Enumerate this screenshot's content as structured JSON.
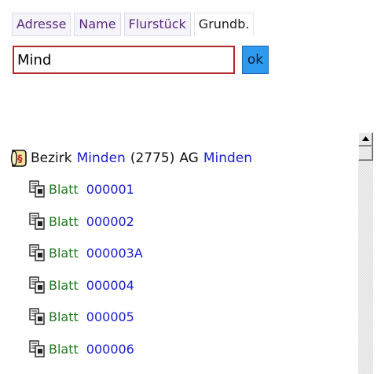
{
  "tabs": [
    {
      "label": "Adresse",
      "active": false
    },
    {
      "label": "Name",
      "active": false
    },
    {
      "label": "Flurstück",
      "active": false
    },
    {
      "label": "Grundb.",
      "active": true
    }
  ],
  "search": {
    "value": "Mind",
    "button_label": "ok"
  },
  "district": {
    "icon": "paragraph-seal-icon",
    "prefix": "Bezirk",
    "name": "Minden",
    "code": "(2775)",
    "court_prefix": "AG",
    "court": "Minden"
  },
  "sheets": [
    {
      "label": "Blatt",
      "number": "000001",
      "icon": "register-sheet-icon"
    },
    {
      "label": "Blatt",
      "number": "000002",
      "icon": "register-sheet-icon"
    },
    {
      "label": "Blatt",
      "number": "000003A",
      "icon": "register-sheet-icon"
    },
    {
      "label": "Blatt",
      "number": "000004",
      "icon": "register-sheet-icon"
    },
    {
      "label": "Blatt",
      "number": "000005",
      "icon": "register-sheet-icon"
    },
    {
      "label": "Blatt",
      "number": "000006",
      "icon": "register-sheet-icon"
    }
  ],
  "colors": {
    "tab_text": "#5c2a7e",
    "input_border": "#b3282d",
    "ok_button": "#2e9bf0",
    "link_blue": "#1b21c9",
    "sheet_green": "#1c7a1c"
  }
}
